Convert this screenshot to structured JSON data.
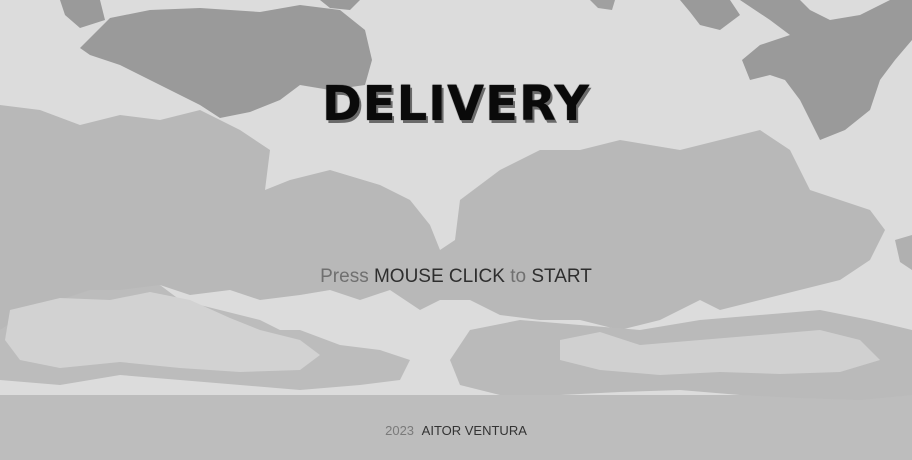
{
  "game": {
    "title": "DELIVERY",
    "prompt": {
      "press": "Press",
      "input": "MOUSE CLICK",
      "to": "to",
      "action": "START"
    },
    "credits": {
      "year": "2023",
      "author": "AITOR VENTURA"
    }
  },
  "colors": {
    "background": "#dcdcdc",
    "landmass_dark": "#9a9a9a",
    "landmass_mid": "#b8b8b8",
    "landmass_light": "#c4c4c4"
  }
}
